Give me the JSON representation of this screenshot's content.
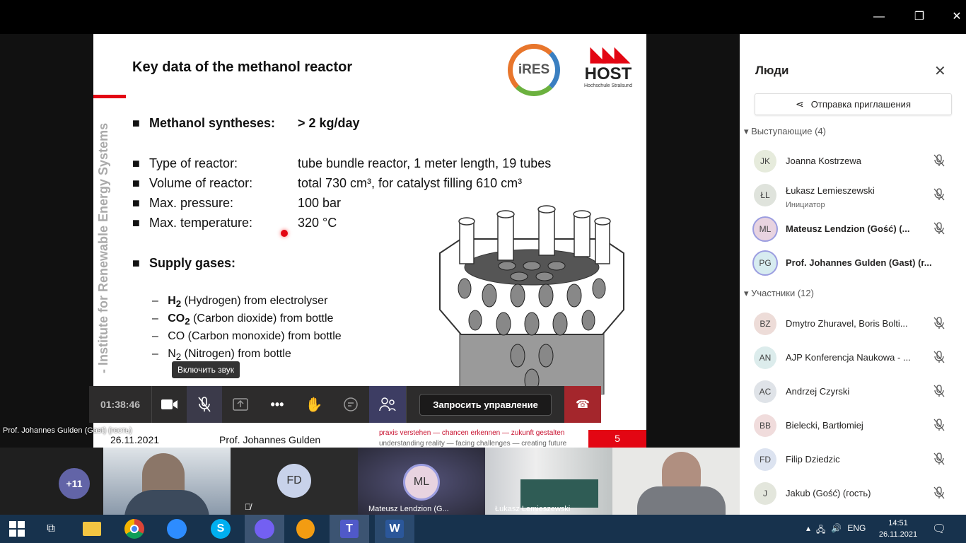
{
  "window": {
    "minimize": "—",
    "maximize": "❐",
    "close": "✕"
  },
  "slide": {
    "title": "Key data of the methanol reactor",
    "vertical_text": "- Institute for Renewable Energy Systems",
    "logo_ires": "iRES",
    "logo_host": "HOST",
    "logo_host_sub": "Hochschule Stralsund",
    "bullets": [
      {
        "label": "Methanol syntheses:",
        "value": "> 2 kg/day"
      },
      {
        "label": "Type of reactor:",
        "value": "tube bundle reactor, 1 meter length, 19 tubes"
      },
      {
        "label": "Volume of reactor:",
        "value": "total 730 cm³, for catalyst filling 610 cm³"
      },
      {
        "label": "Max. pressure:",
        "value": "100 bar"
      },
      {
        "label": "Max. temperature:",
        "value": "320 °C"
      },
      {
        "label": "Supply gases:"
      }
    ],
    "gases": [
      {
        "formula": "H",
        "sub": "2",
        "rest": " (Hydrogen) from electrolyser"
      },
      {
        "formula": "CO",
        "sub": "2",
        "rest": " (Carbon dioxide) from bottle"
      },
      {
        "formula": "",
        "sub": "",
        "rest": "CO (Carbon monoxide) from bottle"
      },
      {
        "formula": "N",
        "sub": "2",
        "rest": " (Nitrogen) from bottle"
      }
    ],
    "footer_date": "26.11.2021",
    "footer_name": "Prof. Johannes Gulden",
    "motto_de": "praxis verstehen — chancen erkennen — zukunft gestalten",
    "motto_en": "understanding reality — facing challenges — creating future",
    "page": "5"
  },
  "presenter_label": "Prof. Johannes Gulden (Gast) (гость)",
  "tooltip": "Включить звук",
  "toolbar": {
    "timer": "01:38:46",
    "request_control": "Запросить управление"
  },
  "strip": {
    "overflow": "+11",
    "tiles": [
      {
        "initials": "FD"
      },
      {
        "initials": "ML",
        "label": "Mateusz Lendzion (G..."
      },
      {
        "label": "Łukasz Lemieszewski"
      }
    ]
  },
  "panel": {
    "title": "Люди",
    "invite": "Отправка приглашения",
    "presenters_header": "Выступающие (4)",
    "presenters": [
      {
        "initials": "JK",
        "name": "Joanna Kostrzewa",
        "color": "#e6ebdc"
      },
      {
        "initials": "ŁL",
        "name": "Łukasz Lemieszewski",
        "sub": "Инициатор",
        "color": "#dfe3dc"
      },
      {
        "initials": "ML",
        "name": "Mateusz Lendzion (Gość) (...",
        "bold": true,
        "color": "#e8d3e0"
      },
      {
        "initials": "PG",
        "name": "Prof. Johannes Gulden (Gast) (r...",
        "bold": true,
        "color": "#d7ecf0",
        "nomic": true
      }
    ],
    "attendees_header": "Участники (12)",
    "attendees": [
      {
        "initials": "BZ",
        "name": "Dmytro Zhuravel, Boris Bolti...",
        "color": "#eddcd8"
      },
      {
        "initials": "AN",
        "name": "AJP Konferencja Naukowa - ...",
        "color": "#dcecec"
      },
      {
        "initials": "AC",
        "name": "Andrzej Czyrski",
        "color": "#dfe3e8"
      },
      {
        "initials": "BB",
        "name": "Bielecki, Bartłomiej",
        "color": "#f0dcdc"
      },
      {
        "initials": "FD",
        "name": "Filip Dziedzic",
        "color": "#dce3f0"
      },
      {
        "initials": "J",
        "name": "Jakub (Gość) (гость)",
        "color": "#e3e6dc"
      }
    ]
  },
  "taskbar": {
    "lang": "ENG",
    "time": "14:51",
    "date": "26.11.2021"
  }
}
